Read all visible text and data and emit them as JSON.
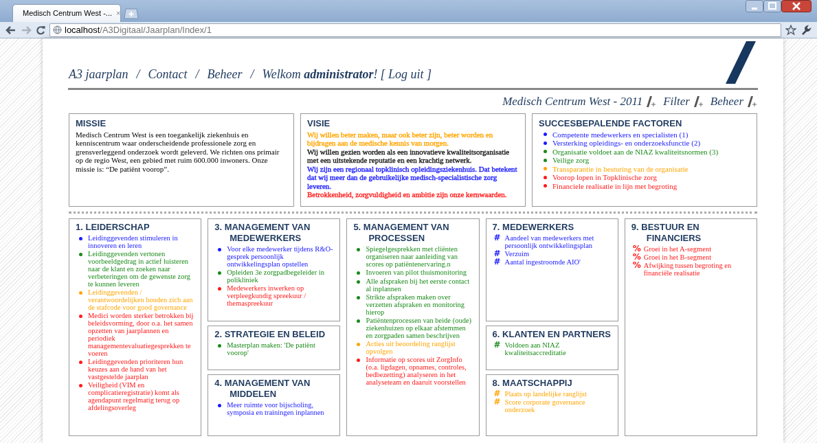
{
  "browser": {
    "tab_title": "Medisch Centrum West -...",
    "tab_close": "×",
    "url_host": "localhost",
    "url_path": "/A3Digitaal/Jaarplan/Index/1"
  },
  "nav": {
    "links": [
      "A3 jaarplan",
      "Contact",
      "Beheer"
    ],
    "separator": "/",
    "welcome": "Welkom **administrator**!",
    "logout": "[ Log uit ]"
  },
  "subheader": {
    "title": "Medisch Centrum West - 2011",
    "links": [
      "Filter",
      "Beheer"
    ]
  },
  "missie": {
    "title": "MISSIE",
    "text": "Medisch Centrum West is een toegankelijk ziekenhuis en kenniscentrum waar onderscheidende professionele zorg en grensverleggend onderzoek wordt geleverd. We richten ons primair op de regio West, een gebied met ruim 600.000 inwoners. Onze missie is: “De patiënt voorop”."
  },
  "visie": {
    "title": "VISIE",
    "paragraphs": [
      {
        "text": "Wij willen beter maken, maar ook beter zijn, beter worden en bijdragen aan de medische kennis van morgen.",
        "color": "#ffa500"
      },
      {
        "text": "Wij willen gezien worden als een innovatieve kwaliteitsorganisatie met een uitstekende reputatie en een krachtig netwerk.",
        "color": "#1a1a1a"
      },
      {
        "text": "Wij zijn een regionaal topklinisch opleidingsziekenhuis. Dat betekent dat wij meer dan de gebruikelijke medisch-specialistische zorg leveren.",
        "color": "#1a1aff"
      },
      {
        "text": "Betrokkenheid, zorgvuldigheid en ambitie zijn onze kernwaarden.",
        "color": "#ff1a1a"
      }
    ]
  },
  "factoren": {
    "title": "SUCCESBEPALENDE FACTOREN",
    "items": [
      {
        "text": "Competente medewerkers en specialisten (1)",
        "color": "#1a1aff"
      },
      {
        "text": "Versterking opleidings- en onderzoeksfunctie (2)",
        "color": "#1a1aff"
      },
      {
        "text": "Organisatie voldoet aan de NIAZ kwaliteitsnormen (3)",
        "color": "#1a8a1a"
      },
      {
        "text": "Veilige zorg",
        "color": "#1a8a1a"
      },
      {
        "text": "Transparantie in besturing van de organisatie",
        "color": "#ffa500"
      },
      {
        "text": "Voorop lopen in Topklinische zorg",
        "color": "#ff1a1a"
      },
      {
        "text": "Financiele realisatie in lijn met begroting",
        "color": "#ff1a1a"
      }
    ]
  },
  "columns": [
    {
      "sections": [
        {
          "title": "1. LEIDERSCHAP",
          "items": [
            {
              "text": "Leidinggevenden stimuleren in innoveren en leren",
              "color": "#1a1aff"
            },
            {
              "text": "Leidinggevenden vertonen voorbeeldgedrag in actief luisteren naar de klant en zoeken naar verbeteringen om de gewenste zorg te kunnen leveren",
              "color": "#1a8a1a"
            },
            {
              "text": "Leidinggevenden / verantwoordelijken houden zich aan de stafcode voor good governance",
              "color": "#ffa500"
            },
            {
              "text": "Medici worden sterker betrokken bij beleidsvorming, door o.a. het samen opzetten van jaarplannen en periodiek managementevaluatiegesprekken te voeren",
              "color": "#ff1a1a"
            },
            {
              "text": "Leidinggevenden prioriteren hun keuzes aan de hand van het vastgestelde jaarplan",
              "color": "#ff1a1a"
            },
            {
              "text": "Veiligheid (VIM en complicatieregistratie) komt als agendapunt regelmatig terug op afdelingsoverleg",
              "color": "#ff1a1a"
            }
          ]
        }
      ]
    },
    {
      "sections": [
        {
          "title": "3. MANAGEMENT VAN MEDEWERKERS",
          "items": [
            {
              "text": "Voor elke medewerker tijdens R&O-gesprek persoonlijk ontwikkelingsplan opstellen",
              "color": "#1a1aff"
            },
            {
              "text": "Opleiden 3e zorgpadbegeleider in polikliniek",
              "color": "#1a8a1a"
            },
            {
              "text": "Medewerkers inwerken op verpleegkundig spreekuur / themaspreekuur",
              "color": "#ff1a1a"
            }
          ]
        },
        {
          "title": "2. STRATEGIE EN BELEID",
          "items": [
            {
              "text": "Masterplan maken: 'De patiënt voorop'",
              "color": "#1a8a1a"
            }
          ]
        },
        {
          "title": "4. MANAGEMENT VAN MIDDELEN",
          "items": [
            {
              "text": "Meer ruimte voor bijscholing, symposia en trainingen inplannen",
              "color": "#1a1aff"
            }
          ]
        }
      ]
    },
    {
      "sections": [
        {
          "title": "5. MANAGEMENT VAN PROCESSEN",
          "items": [
            {
              "text": "Spiegelgesprekken met cliënten organiseren naar aanleiding van scores op patiëntenervaring.n",
              "color": "#1a8a1a"
            },
            {
              "text": "Invoeren van pilot thuismonitoring",
              "color": "#1a8a1a"
            },
            {
              "text": "Alle afspraken bij het eerste contact al inplannen",
              "color": "#1a8a1a"
            },
            {
              "text": "Strikte afspraken maken over verzetten afspraken en monitoring hierop",
              "color": "#1a8a1a"
            },
            {
              "text": "Patiëntenprocessen van beide (oude) ziekenhuizen op elkaar afstemmen en zorgpaden samen beschrijven",
              "color": "#1a8a1a"
            },
            {
              "text": "Acties uit beoordeling ranglijst opvolgen",
              "color": "#ffa500"
            },
            {
              "text": "Informatie op scores uit ZorgInfo (o.a. ligdagen, opnames, controles, bedbezetting) analyseren in het analyseteam en daaruit voorstellen",
              "color": "#ff1a1a"
            }
          ]
        }
      ]
    },
    {
      "sections": [
        {
          "title": "7. MEDEWERKERS",
          "items": [
            {
              "marker": "#",
              "text": "Aandeel van medewerkers met persoonlijk ontwikkelingsplan",
              "color": "#1a1aff"
            },
            {
              "marker": "#",
              "text": "Verzuim",
              "color": "#1a1aff"
            },
            {
              "marker": "#",
              "text": "Aantal ingestroomde AIO'",
              "color": "#1a1aff"
            }
          ]
        },
        {
          "title": "6. KLANTEN EN PARTNERS",
          "items": [
            {
              "marker": "#",
              "text": "Voldoen aan NIAZ kwaliteitsaccreditatie",
              "color": "#1a8a1a"
            }
          ]
        },
        {
          "title": "8. MAATSCHAPPIJ",
          "items": [
            {
              "marker": "#",
              "text": "Plaats op landelijke ranglijst",
              "color": "#ffa500"
            },
            {
              "marker": "#",
              "text": "Score corporate governance onderzoek",
              "color": "#ffa500"
            }
          ]
        }
      ]
    },
    {
      "sections": [
        {
          "title": "9. BESTUUR EN FINANCIERS",
          "items": [
            {
              "marker": "%",
              "text": "Groei in het A-segment",
              "color": "#ff1a1a"
            },
            {
              "marker": "%",
              "text": "Groei in het B-segment",
              "color": "#ff1a1a"
            },
            {
              "marker": "%",
              "text": "Afwijking tussen begroting en financiële realisatie",
              "color": "#ff1a1a"
            }
          ]
        }
      ]
    }
  ]
}
